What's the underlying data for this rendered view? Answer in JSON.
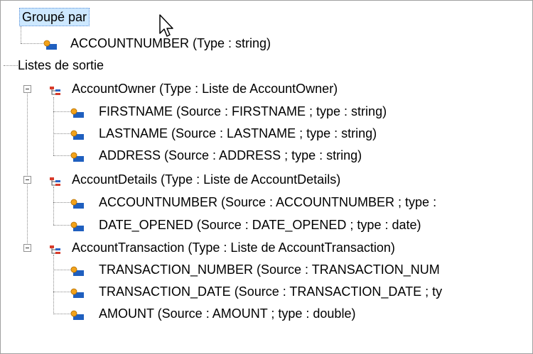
{
  "tree": {
    "grouped_by": {
      "label": "Groupé par",
      "items": [
        {
          "label": "ACCOUNTNUMBER (Type : string)"
        }
      ]
    },
    "output_lists": {
      "label": "Listes de sortie",
      "groups": [
        {
          "label": "AccountOwner (Type : Liste de AccountOwner)",
          "items": [
            {
              "label": "FIRSTNAME (Source : FIRSTNAME ; type : string)"
            },
            {
              "label": "LASTNAME (Source : LASTNAME ; type : string)"
            },
            {
              "label": "ADDRESS (Source : ADDRESS ; type : string)"
            }
          ]
        },
        {
          "label": "AccountDetails (Type : Liste de AccountDetails)",
          "items": [
            {
              "label": "ACCOUNTNUMBER (Source : ACCOUNTNUMBER ; type :"
            },
            {
              "label": "DATE_OPENED (Source : DATE_OPENED ; type : date)"
            }
          ]
        },
        {
          "label": "AccountTransaction (Type : Liste de AccountTransaction)",
          "items": [
            {
              "label": "TRANSACTION_NUMBER (Source : TRANSACTION_NUM"
            },
            {
              "label": "TRANSACTION_DATE (Source : TRANSACTION_DATE ; ty"
            },
            {
              "label": "AMOUNT (Source : AMOUNT ; type : double)"
            }
          ]
        }
      ]
    }
  },
  "colors": {
    "selection_bg": "#cde8ff",
    "attr_icon_blue": "#1f5fbf",
    "attr_icon_orange": "#f2a21a",
    "group_icon_red": "#d83b2a",
    "group_icon_blue": "#2a64c8"
  }
}
